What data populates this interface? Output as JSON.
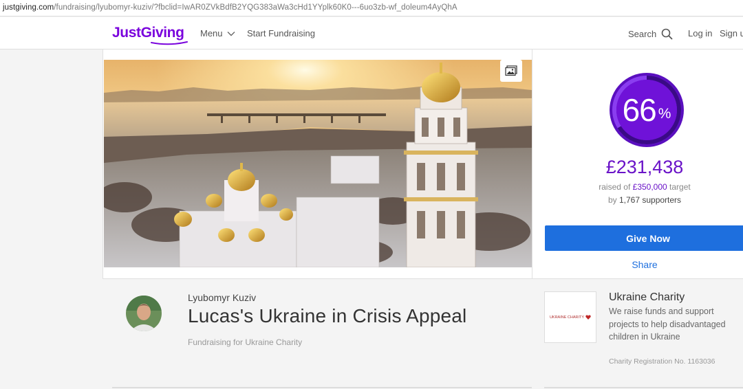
{
  "browser": {
    "url_host": "justgiving.com",
    "url_path": "/fundraising/lyubomyr-kuziv/?fbclid=IwAR0ZVkBdfB2YQG383aWa3cHd1YYplk60K0---6uo3zb-wf_doleum4AyQhA"
  },
  "header": {
    "logo_text": "JustGiving",
    "menu_label": "Menu",
    "start_fundraising_label": "Start Fundraising",
    "search_label": "Search",
    "login_label": "Log in",
    "signup_label": "Sign u"
  },
  "donation": {
    "percent": "66",
    "percent_symbol": "%",
    "percent_fraction": 0.66,
    "raised": "£231,438",
    "target_prefix": "raised of",
    "target_amount": "£350,000",
    "target_suffix": "target",
    "supporters_prefix": "by",
    "supporters_count": "1,767",
    "supporters_suffix": "supporters",
    "give_label": "Give Now",
    "share_label": "Share"
  },
  "page": {
    "owner": "Lyubomyr Kuziv",
    "title": "Lucas's Ukraine in Crisis Appeal",
    "fundraising_for": "Fundraising for Ukraine Charity"
  },
  "charity": {
    "logo_text": "UKRAINE CHARITY",
    "name": "Ukraine Charity",
    "description": "We raise funds and support projects to help disadvantaged children in Ukraine",
    "registration": "Charity Registration No. 1163036"
  },
  "colors": {
    "brand": "#7a04dd",
    "accent_purple": "#6a13c8",
    "button_blue": "#1e6fde"
  }
}
